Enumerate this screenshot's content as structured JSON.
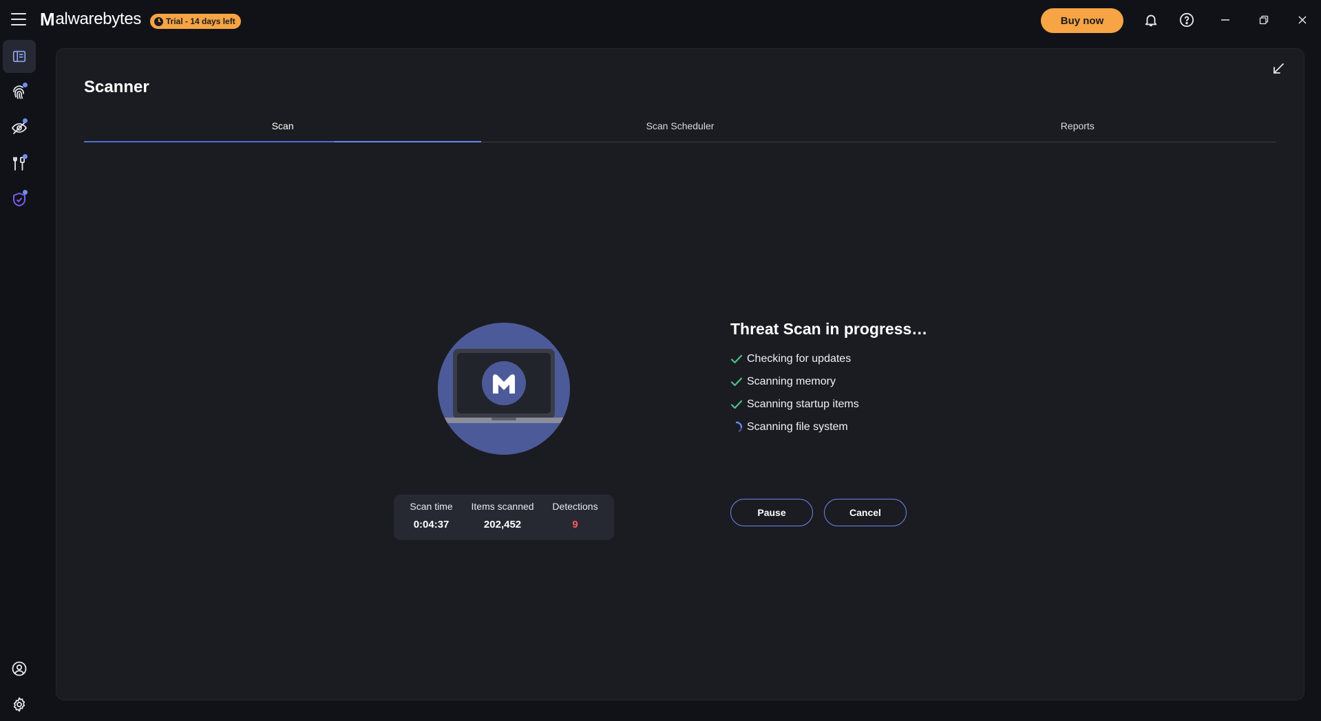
{
  "app": {
    "logo_mark": "M",
    "logo_text": "alwarebytes",
    "trial_badge": "Trial - 14 days left",
    "buy_label": "Buy now"
  },
  "colors": {
    "accent": "#6b8af2",
    "cta": "#f6a444",
    "danger": "#ff5a5a",
    "background": "#111217",
    "panel": "#1b1c22"
  },
  "sidebar": {
    "items": [
      {
        "icon": "dashboard-icon",
        "active": true,
        "badge": false
      },
      {
        "icon": "fingerprint-icon",
        "active": false,
        "badge": true
      },
      {
        "icon": "privacy-eye-icon",
        "active": false,
        "badge": true
      },
      {
        "icon": "tools-icon",
        "active": false,
        "badge": true
      },
      {
        "icon": "identity-shield-icon",
        "active": false,
        "badge": true
      }
    ],
    "bottom": [
      {
        "icon": "account-icon"
      },
      {
        "icon": "settings-gear-icon"
      }
    ]
  },
  "page": {
    "title": "Scanner",
    "tabs": [
      {
        "label": "Scan",
        "active": true
      },
      {
        "label": "Scan Scheduler",
        "active": false
      },
      {
        "label": "Reports",
        "active": false
      }
    ]
  },
  "scan": {
    "status_title": "Threat Scan in progress…",
    "steps": [
      {
        "label": "Checking for updates",
        "state": "done"
      },
      {
        "label": "Scanning memory",
        "state": "done"
      },
      {
        "label": "Scanning startup items",
        "state": "done"
      },
      {
        "label": "Scanning file system",
        "state": "running"
      }
    ],
    "stats": {
      "scan_time_label": "Scan time",
      "scan_time_value": "0:04:37",
      "items_label": "Items scanned",
      "items_value": "202,452",
      "detections_label": "Detections",
      "detections_value": "9"
    },
    "pause_label": "Pause",
    "cancel_label": "Cancel"
  }
}
